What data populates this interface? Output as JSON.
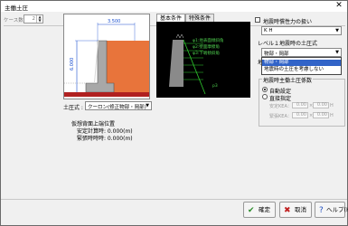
{
  "window": {
    "title": "主働土圧",
    "close_glyph": "✕"
  },
  "case": {
    "label": "ケース数 :",
    "value": "2"
  },
  "diagram": {
    "width_dim": "3.500",
    "height_dim": "6.000"
  },
  "soil": {
    "label": "土圧式 :",
    "value": "クーロン(修正物部・岡部)"
  },
  "info": {
    "title": "仮想背面上端位置",
    "line1": "安定計算時: 0.000(m)",
    "line2": "緊張時時時: 0.000(m)"
  },
  "tabs": [
    {
      "label": "基本条件"
    },
    {
      "label": "特殊条件"
    }
  ],
  "panel": {
    "labels": [
      "φ1:地表面傾斜角",
      "φ2:壁面摩擦角",
      "φ3:下端傾斜角"
    ],
    "p3": "p3"
  },
  "right": {
    "seismic_check": "地震時慣性力の扱い",
    "seismic_value": "K H",
    "level1_check": "レベル１地震時の土圧式",
    "level1_value": "物部・岡部",
    "level1_label2": "地震",
    "options": [
      "物部・岡部",
      "地震時の土圧を考慮しない"
    ],
    "group_title": "地震時主働土圧係数",
    "radio_auto": "自動設定",
    "radio_direct": "直接指定",
    "stable_label": "安定KEA：",
    "stable_v1": "0.00",
    "stable_v2": "0.00",
    "anchor_label": "緊張KEA：",
    "anchor_v1": "0.00",
    "anchor_v2": "0.00",
    "unit": "H"
  },
  "buttons": {
    "ok": "確定",
    "cancel": "取消",
    "help": "ヘルプ(H)"
  }
}
